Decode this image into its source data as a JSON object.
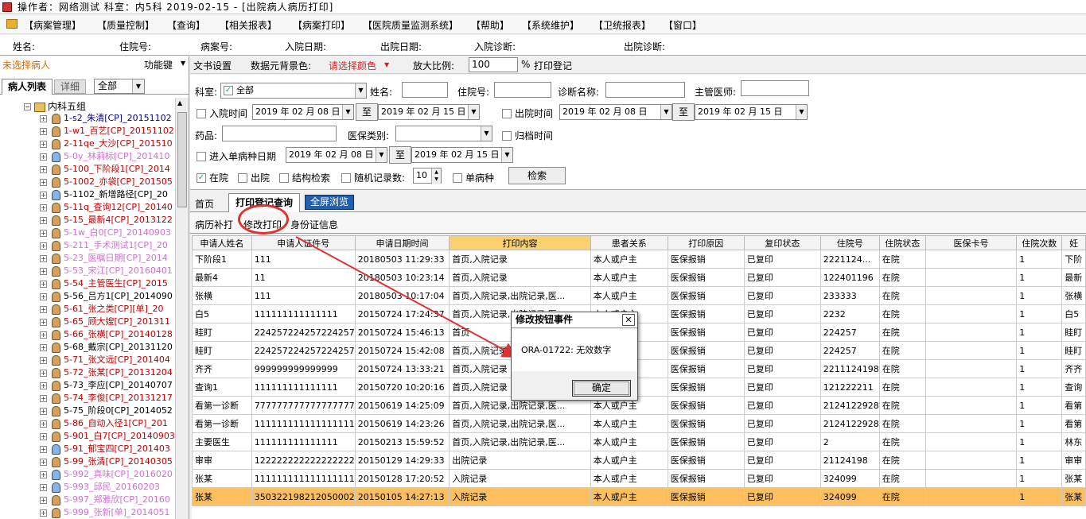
{
  "titlebar": {
    "title": "操作者：网络测试  科室：内5科  2019-02-15 - [出院病人病历打印]"
  },
  "menu": [
    "【病案管理】",
    "【质量控制】",
    "【查询】",
    "【相关报表】",
    "【病案打印】",
    "【医院质量监测系统】",
    "【帮助】",
    "【系统维护】",
    "【卫统报表】",
    "【窗口】"
  ],
  "infobar": {
    "name": "姓名:",
    "inpatient_no": "住院号:",
    "case_no": "病案号:",
    "admit_date": "入院日期:",
    "discharge_date": "出院日期:",
    "admit_diag": "入院诊断:",
    "discharge_diag": "出院诊断:"
  },
  "left": {
    "unselected": "未选择病人",
    "funckey": "功能键",
    "tab_patients": "病人列表",
    "tab_detail": "详细",
    "filter": "全部",
    "root": "内科五组",
    "patients": [
      {
        "label": "1-s2_朱清[CP]_20151102",
        "color": "#000080",
        "icon": "brown"
      },
      {
        "label": "1-w1_百艺[CP]_20151102",
        "color": "#c00000",
        "icon": "brown"
      },
      {
        "label": "2-11qe_大沙[CP]_201510",
        "color": "#c00000",
        "icon": "brown"
      },
      {
        "label": "5-0y_林莉标[CP]_201410",
        "color": "#d070d0",
        "icon": "blue"
      },
      {
        "label": "5-100_下阶段1[CP]_2014",
        "color": "#c00000",
        "icon": "brown"
      },
      {
        "label": "5-1002_亦袋[CP]_201505",
        "color": "#c00000",
        "icon": "brown"
      },
      {
        "label": "5-1102_新增路径[CP]_20",
        "color": "#000000",
        "icon": "blue"
      },
      {
        "label": "5-11q_查询12[CP]_20140",
        "color": "#c00000",
        "icon": "brown"
      },
      {
        "label": "5-15_最新4[CP]_2013122",
        "color": "#c00000",
        "icon": "brown"
      },
      {
        "label": "5-1w_白0[CP]_20140903",
        "color": "#d070d0",
        "icon": "brown"
      },
      {
        "label": "5-211_手术测试1[CP]_20",
        "color": "#d070d0",
        "icon": "brown"
      },
      {
        "label": "5-23_医嘱日期[CP]_2014",
        "color": "#d070d0",
        "icon": "brown"
      },
      {
        "label": "5-53_宋江[CP]_20160401",
        "color": "#d070d0",
        "icon": "brown"
      },
      {
        "label": "5-54_主管医生[CP]_2015",
        "color": "#c00000",
        "icon": "brown"
      },
      {
        "label": "5-56_吕方1[CP]_2014090",
        "color": "#000000",
        "icon": "brown"
      },
      {
        "label": "5-61_张之类[CP][单]_20",
        "color": "#c00000",
        "icon": "brown"
      },
      {
        "label": "5-65_顾大嫂[CP]_201311",
        "color": "#c00000",
        "icon": "brown"
      },
      {
        "label": "5-66_张横[CP]_20140128",
        "color": "#c00000",
        "icon": "brown"
      },
      {
        "label": "5-68_戴宗[CP]_20131120",
        "color": "#000000",
        "icon": "brown"
      },
      {
        "label": "5-71_张文远[CP]_201404",
        "color": "#c00000",
        "icon": "brown"
      },
      {
        "label": "5-72_张某[CP]_20131204",
        "color": "#c00000",
        "icon": "brown"
      },
      {
        "label": "5-73_李应[CP]_20140707",
        "color": "#000000",
        "icon": "brown"
      },
      {
        "label": "5-74_李俊[CP]_20131217",
        "color": "#c00000",
        "icon": "brown"
      },
      {
        "label": "5-75_阶段0[CP]_2014052",
        "color": "#000000",
        "icon": "brown"
      },
      {
        "label": "5-86_自动入径1[CP]_201",
        "color": "#c00000",
        "icon": "brown"
      },
      {
        "label": "5-901_白7[CP]_20140903",
        "color": "#c00000",
        "icon": "brown"
      },
      {
        "label": "5-91_郁宝四[CP]_201403",
        "color": "#c00000",
        "icon": "blue"
      },
      {
        "label": "5-99_张清[CP]_20140305",
        "color": "#c00000",
        "icon": "brown"
      },
      {
        "label": "5-992_真味[CP]_2016020",
        "color": "#d070d0",
        "icon": "blue"
      },
      {
        "label": "5-993_邱民_20160203",
        "color": "#d070d0",
        "icon": "blue"
      },
      {
        "label": "5-997_郑雅欣[CP]_20160",
        "color": "#d070d0",
        "icon": "brown"
      },
      {
        "label": "5-999_张新[单]_2014051",
        "color": "#d070d0",
        "icon": "brown"
      }
    ]
  },
  "toolbar": {
    "doc_settings": "文书设置",
    "bg_label": "数据元背景色:",
    "bg_value": "请选择颜色",
    "zoom_label": "放大比例:",
    "zoom_value": "100",
    "pct": "%",
    "print_reg": "打印登记"
  },
  "search": {
    "dept_label": "科室:",
    "dept_value": "全部",
    "name_label": "姓名:",
    "inp_label": "住院号:",
    "diag_label": "诊断名称:",
    "doctor_label": "主管医师:",
    "admit_time": "入院时间",
    "date_from": "2019 年 02 月 08 日",
    "to": "至",
    "date_to": "2019 年 02 月 15 日",
    "discharge_time": "出院时间",
    "drug_label": "药品:",
    "ins_label": "医保类别:",
    "archive_time": "归档时间",
    "single_disease_date": "进入单病种日期",
    "in_hospital": "在院",
    "discharged": "出院",
    "structure_search": "结构检索",
    "random_count": "随机记录数:",
    "random_value": "10",
    "single_disease": "单病种",
    "search_btn": "检索"
  },
  "tabs": {
    "home": "首页",
    "print_query": "打印登记查询",
    "fullscreen": "全屏浏览"
  },
  "subbar": {
    "supplement": "病历补打",
    "modify_print": "修改打印",
    "id_info": "身份证信息"
  },
  "table": {
    "headers": [
      "申请人姓名",
      "申请人证件号",
      "申请日期时间",
      "打印内容",
      "患者关系",
      "打印原因",
      "复印状态",
      "住院号",
      "住院状态",
      "医保卡号",
      "住院次数",
      "妊"
    ],
    "rows": [
      [
        "下阶段1",
        "111",
        "20180503 11:29:33",
        "首页,入院记录",
        "本人或户主",
        "医保报销",
        "已复印",
        "2221124...",
        "在院",
        "",
        "1",
        "下阶"
      ],
      [
        "最新4",
        "11",
        "20180503 10:23:14",
        "首页,入院记录",
        "本人或户主",
        "医保报销",
        "已复印",
        "122401196",
        "在院",
        "",
        "1",
        "最新"
      ],
      [
        "张横",
        "111",
        "20180503 10:17:04",
        "首页,入院记录,出院记录,医...",
        "本人或户主",
        "医保报销",
        "已复印",
        "233333",
        "在院",
        "",
        "1",
        "张横"
      ],
      [
        "白5",
        "111111111111111",
        "20150724 17:24:37",
        "首页,入院记录,出院记录,医...",
        "本人或户主",
        "医保报销",
        "已复印",
        "2232",
        "在院",
        "",
        "1",
        "白5"
      ],
      [
        "眭盯",
        "224257224257224257",
        "20150724 15:46:13",
        "首页",
        "本人或户主",
        "医保报销",
        "已复印",
        "224257",
        "在院",
        "",
        "1",
        "眭盯"
      ],
      [
        "眭盯",
        "224257224257224257",
        "20150724 15:42:08",
        "首页,入院记录",
        "本人或户主",
        "医保报销",
        "已复印",
        "224257",
        "在院",
        "",
        "1",
        "眭盯"
      ],
      [
        "齐齐",
        "999999999999999",
        "20150724 13:33:21",
        "首页,入院记录",
        "本人或户主",
        "医保报销",
        "已复印",
        "2211124198",
        "在院",
        "",
        "1",
        "齐齐"
      ],
      [
        "查询1",
        "111111111111111",
        "20150720 10:20:16",
        "首页,入院记录",
        "本人或户主",
        "医保报销",
        "已复印",
        "121222211",
        "在院",
        "",
        "1",
        "查询"
      ],
      [
        "看第一诊断",
        "777777777777777777",
        "20150619 14:25:09",
        "首页,入院记录,出院记录,医...",
        "本人或户主",
        "医保报销",
        "已复印",
        "2124122928",
        "在院",
        "",
        "1",
        "看第"
      ],
      [
        "看第一诊断",
        "111111111111111111",
        "20150619 14:23:26",
        "首页,入院记录,出院记录,医...",
        "本人或户主",
        "医保报销",
        "已复印",
        "2124122928",
        "在院",
        "",
        "1",
        "看第"
      ],
      [
        "主要医生",
        "111111111111111",
        "20150213 15:59:52",
        "首页,入院记录,出院记录,医...",
        "本人或户主",
        "医保报销",
        "已复印",
        "2",
        "在院",
        "",
        "1",
        "林东"
      ],
      [
        "审审",
        "122222222222222222",
        "20150129 14:29:33",
        "出院记录",
        "本人或户主",
        "医保报销",
        "已复印",
        "21124198",
        "在院",
        "",
        "1",
        "审审"
      ],
      [
        "张某",
        "111111111111111111",
        "20150128 17:20:52",
        "入院记录",
        "本人或户主",
        "医保报销",
        "已复印",
        "324099",
        "在院",
        "",
        "1",
        "张某"
      ],
      [
        "张某",
        "350322198212050002",
        "20150105 14:27:13",
        "入院记录",
        "本人或户主",
        "医保报销",
        "已复印",
        "324099",
        "在院",
        "",
        "1",
        "张某"
      ]
    ]
  },
  "dialog": {
    "title": "修改按钮事件",
    "close": "✕",
    "message": "ORA-01722: 无效数字",
    "ok": "确定"
  }
}
